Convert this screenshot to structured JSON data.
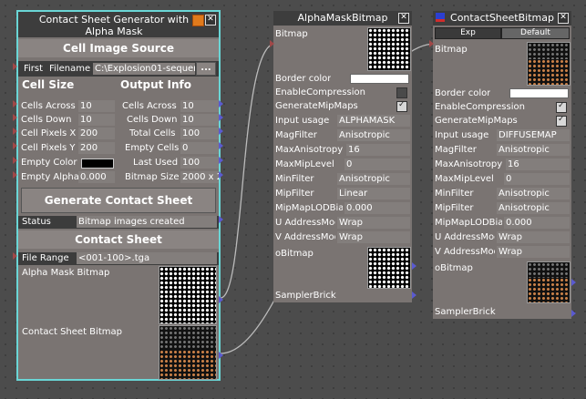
{
  "csg": {
    "title": "Contact Sheet Generator with Alpha Mask",
    "cell_image_source": "Cell Image Source",
    "first_label": "First",
    "filename_label": "Filename",
    "filename_value": "C:\\Explosion01-sequen",
    "browse_label": "...",
    "cell_size_label": "Cell Size",
    "output_info_label": "Output Info",
    "left_fields": [
      {
        "label": "Cells Across",
        "value": "10"
      },
      {
        "label": "Cells Down",
        "value": "10"
      },
      {
        "label": "Cell Pixels X",
        "value": "200"
      },
      {
        "label": "Cell Pixels Y",
        "value": "200"
      },
      {
        "label": "Empty Color",
        "value": ""
      },
      {
        "label": "Empty Alpha",
        "value": "0.000"
      }
    ],
    "right_fields": [
      {
        "label": "Cells Across",
        "value": "10"
      },
      {
        "label": "Cells Down",
        "value": "10"
      },
      {
        "label": "Total Cells",
        "value": "100"
      },
      {
        "label": "Empty Cells",
        "value": "0"
      },
      {
        "label": "Last Used",
        "value": "100"
      },
      {
        "label": "Bitmap Size",
        "value": "2000 x 2"
      }
    ],
    "generate_button": "Generate Contact Sheet",
    "status_label": "Status",
    "status_value": "Bitmap images created",
    "contact_sheet_label": "Contact Sheet",
    "file_range_label": "File Range",
    "file_range_value": "<001-100>.tga",
    "alpha_mask_bitmap_label": "Alpha Mask Bitmap",
    "contact_sheet_bitmap_label": "Contact Sheet Bitmap",
    "accent_color": "#6ad6d6",
    "empty_color": "#000000"
  },
  "amb": {
    "title": "AlphaMaskBitmap",
    "bitmap_label": "Bitmap",
    "border_color_label": "Border color",
    "enable_compression_label": "EnableCompression",
    "enable_compression_checked": false,
    "generate_mipmaps_label": "GenerateMipMaps",
    "generate_mipmaps_checked": true,
    "fields": [
      {
        "label": "Input usage",
        "value": "ALPHAMASK"
      },
      {
        "label": "MagFilter",
        "value": "Anisotropic"
      },
      {
        "label": "MaxAnisotropy",
        "value": "16"
      },
      {
        "label": "MaxMipLevel",
        "value": "0"
      },
      {
        "label": "MinFilter",
        "value": "Anisotropic"
      },
      {
        "label": "MipFilter",
        "value": "Linear"
      },
      {
        "label": "MipMapLODBias",
        "value": "0.000"
      },
      {
        "label": "U  AddressMode",
        "value": "Wrap"
      },
      {
        "label": "V  AddressMode",
        "value": "Wrap"
      }
    ],
    "obitmap_label": "oBitmap",
    "sampler_label": "SamplerBrick"
  },
  "csb": {
    "title": "ContactSheetBitmap",
    "tab_exp": "Exp",
    "tab_default": "Default",
    "bitmap_label": "Bitmap",
    "border_color_label": "Border color",
    "enable_compression_label": "EnableCompression",
    "enable_compression_checked": true,
    "generate_mipmaps_label": "GenerateMipMaps",
    "generate_mipmaps_checked": true,
    "fields": [
      {
        "label": "Input usage",
        "value": "DIFFUSEMAP"
      },
      {
        "label": "MagFilter",
        "value": "Anisotropic"
      },
      {
        "label": "MaxAnisotropy",
        "value": "16"
      },
      {
        "label": "MaxMipLevel",
        "value": "0"
      },
      {
        "label": "MinFilter",
        "value": "Anisotropic"
      },
      {
        "label": "MipFilter",
        "value": "Anisotropic"
      },
      {
        "label": "MipMapLODBias",
        "value": "0.000"
      },
      {
        "label": "U  AddressMode",
        "value": "Wrap"
      },
      {
        "label": "V  AddressMode",
        "value": "Wrap"
      }
    ],
    "obitmap_label": "oBitmap",
    "sampler_label": "SamplerBrick"
  },
  "icons": {
    "close": "close-icon",
    "minimize": "minimize-icon",
    "app": "node-type-icon"
  }
}
